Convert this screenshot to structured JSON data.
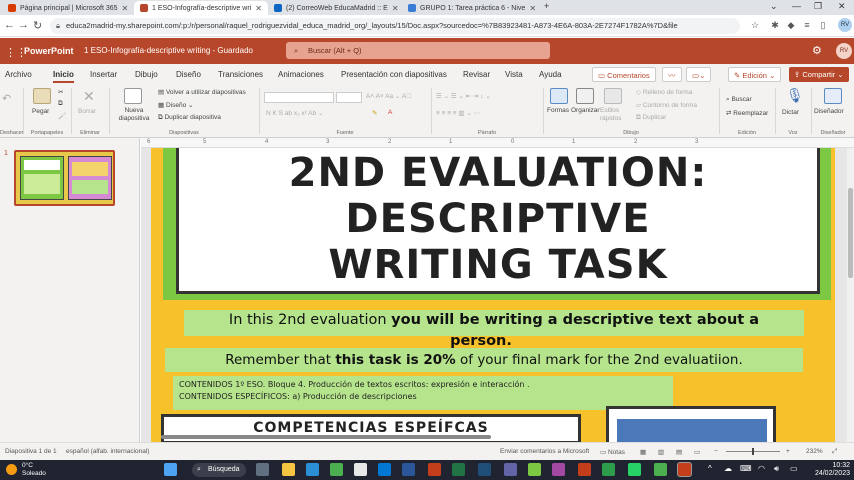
{
  "browser": {
    "tabs": [
      {
        "label": "Página principal | Microsoft 365",
        "color": "#d83b01"
      },
      {
        "label": "1 ESO-Infografía-descriptive wri",
        "color": "#b7472a"
      },
      {
        "label": "(2) CorreoWeb EducaMadrid :: E",
        "color": "#0a66c2"
      },
      {
        "label": "GRUPO 1: Tarea práctica 6 - Nive",
        "color": "#3a7bd5"
      }
    ],
    "new_tab": "+",
    "url": "educa2madrid-my.sharepoint.com/:p:/r/personal/raquel_rodriguezvidal_educa_madrid_org/_layouts/15/Doc.aspx?sourcedoc=%7B8392348​1-A873-4E6A-803A-2E7274F1782A%7D&file",
    "profile_initials": "RV"
  },
  "app": {
    "name": "PowerPoint",
    "document": "1 ESO-Infografía-descriptive writing  -  Guardado",
    "search_placeholder": "Buscar (Alt + Q)",
    "user_initials": "RV"
  },
  "menu": {
    "tabs": [
      "Archivo",
      "Inicio",
      "Insertar",
      "Dibujo",
      "Diseño",
      "Transiciones",
      "Animaciones",
      "Presentación con diapositivas",
      "Revisar",
      "Vista",
      "Ayuda"
    ],
    "selected": "Inicio",
    "comments": "Comentarios",
    "edit_mode": "Edición",
    "share": "Compartir"
  },
  "ribbon": {
    "paste": "Pegar",
    "clipboard_label": "Portapapeles",
    "undo_label": "Deshacer",
    "delete": "Borrar",
    "delete_label": "Eliminar",
    "new_slide": "Nueva diapositiva",
    "reuse": "Volver a utilizar diapositivas",
    "design": "Diseño",
    "duplicate": "Duplicar diapositiva",
    "slides_label": "Diapositivas",
    "font_label": "Fuente",
    "paragraph_label": "Párrafo",
    "shapes": "Formas",
    "arrange": "Organizar",
    "quick_styles": "Estilos rápidos",
    "shape_fill": "Relleno de forma",
    "shape_outline": "Contorno de forma",
    "duplicate_shape": "Duplicar",
    "drawing_label": "Dibujo",
    "find": "Buscar",
    "replace": "Reemplazar",
    "editing_label": "Edición",
    "dictate": "Dictar",
    "voice_label": "Voz",
    "designer": "Diseñador",
    "designer_label": "Diseñador"
  },
  "thumbnails": {
    "number": "1"
  },
  "ruler": {
    "numbers": [
      "6",
      "5",
      "4",
      "3",
      "2",
      "1",
      "0",
      "1",
      "2",
      "3"
    ]
  },
  "slide": {
    "title": "2ND EVALUATION: DESCRIPTIVE WRITING TASK",
    "line1_normal": "In this 2nd evaluation ",
    "line1_bold": "you will be writing a descriptive text about a",
    "line1_cont": "person.",
    "line2_a": "Remember that ",
    "line2_b": "this task is 20%",
    "line2_c": " of your final mark for the 2nd evaluatiion.",
    "contenidos_1": "CONTENIDOS 1º ESO. Bloque 4. Producción de textos escritos: expresión e interacción .",
    "contenidos_2": "CONTENIDOS ESPECÍFICOS: a) Producción de descripciones",
    "competencias": "COMPETENCIAS ESPEÍFCAS"
  },
  "status": {
    "slide_count": "Diapositiva 1 de 1",
    "language": "español (alfab. internacional)",
    "feedback": "Enviar comentarios a Microsoft",
    "notes": "Notas",
    "zoom": "232%"
  },
  "taskbar": {
    "temp": "0°C",
    "weather": "Soleado",
    "search": "Búsqueda",
    "time": "10:32",
    "date": "24/02/2023"
  }
}
